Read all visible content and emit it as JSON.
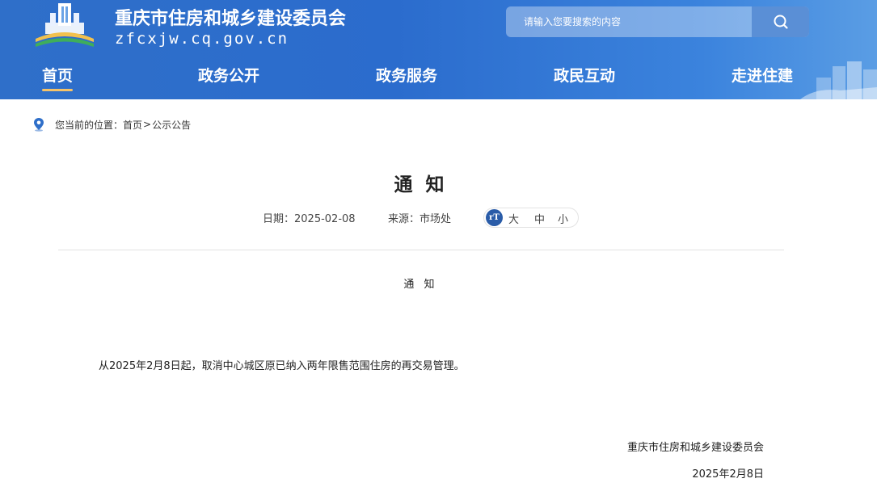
{
  "header": {
    "site_title": "重庆市住房和城乡建设委员会",
    "site_domain": "zfcxjw.cq.gov.cn",
    "search_placeholder": "请输入您要搜索的内容"
  },
  "nav": {
    "items": [
      {
        "label": "首页",
        "active": true
      },
      {
        "label": "政务公开",
        "active": false
      },
      {
        "label": "政务服务",
        "active": false
      },
      {
        "label": "政民互动",
        "active": false
      },
      {
        "label": "走进住建",
        "active": false
      }
    ]
  },
  "breadcrumb": {
    "prefix": "您当前的位置：",
    "items": [
      "首页",
      "公示公告"
    ],
    "separator": ">"
  },
  "article": {
    "title": "通 知",
    "date_text": "日期：2025-02-08",
    "source_text": "来源：市场处",
    "font_size_icon": "rT",
    "font_sizes": [
      "大",
      "中",
      "小"
    ],
    "body_heading": "通 知",
    "body_paragraph": "从2025年2月8日起，取消中心城区原已纳入两年限售范围住房的再交易管理。",
    "sign_org": "重庆市住房和城乡建设委员会",
    "sign_date": "2025年2月8日"
  },
  "colors": {
    "header_blue": "#2f6fc9",
    "nav_active_underline": "#f5c36a",
    "font_icon_blue": "#2a5ca8"
  },
  "icons": {
    "search": "search-icon",
    "location": "location-pin-icon",
    "logo": "emblem-logo",
    "font_size": "font-size-icon"
  }
}
